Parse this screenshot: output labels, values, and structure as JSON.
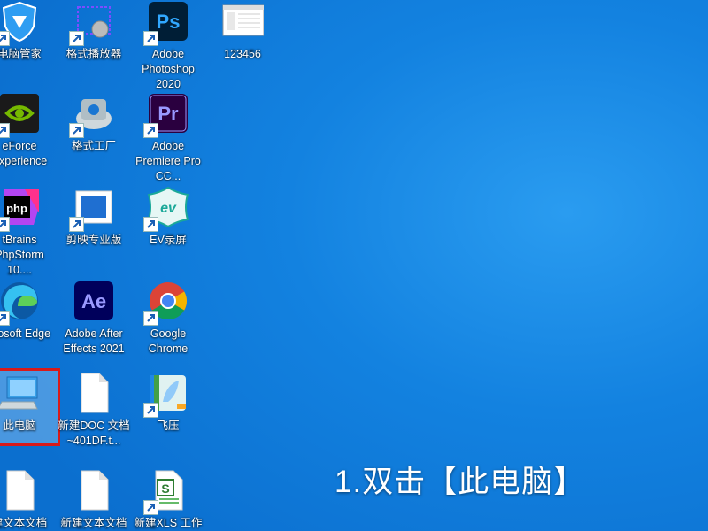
{
  "desktop": {
    "icons": [
      {
        "label": "电脑管家"
      },
      {
        "label": "格式播放器"
      },
      {
        "label": "Adobe Photoshop 2020"
      },
      {
        "label": "123456"
      },
      {
        "label": "eForce Experience"
      },
      {
        "label": "格式工厂"
      },
      {
        "label": "Adobe Premiere Pro CC..."
      },
      {
        "label": "tBrains PhpStorm 10...."
      },
      {
        "label": "剪映专业版"
      },
      {
        "label": "EV录屏"
      },
      {
        "label": "crosoft Edge"
      },
      {
        "label": "Adobe After Effects 2021"
      },
      {
        "label": "Google Chrome"
      },
      {
        "label": "此电脑"
      },
      {
        "label": "新建DOC 文档~401DF.t..."
      },
      {
        "label": "飞压"
      },
      {
        "label": "建文本文档"
      },
      {
        "label": "新建文本文档"
      },
      {
        "label": "新建XLS 工作"
      }
    ],
    "icon_glyph_text": {
      "ps": "Ps",
      "pr": "Pr",
      "ae": "Ae",
      "php": "php",
      "ev": "ev",
      "xls": "S"
    }
  },
  "instruction_caption": "1.双击【此电脑】",
  "colors": {
    "desktop_blue": "#1382e0",
    "selection_border": "#d81a1a",
    "adobe_dark": "#001e36"
  }
}
